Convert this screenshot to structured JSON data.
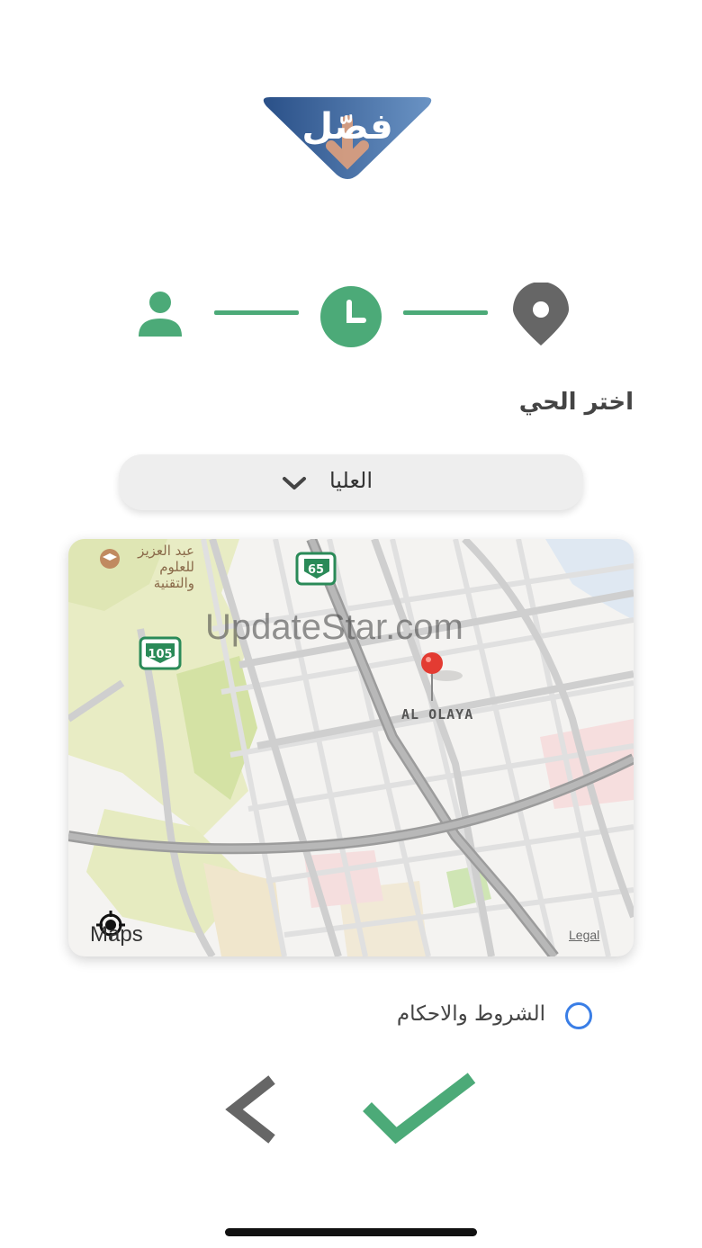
{
  "logo": {
    "text": "فصّل"
  },
  "form": {
    "neighborhood_label": "اختر الحي",
    "district_selected": "العليا"
  },
  "map": {
    "watermark": "UpdateStar.com",
    "district_label": "AL OLAYA",
    "poi_label_line1": "عبد العزيز",
    "poi_label_line2": "للعلوم",
    "poi_label_line3": "والتقنية",
    "shield_1": "65",
    "shield_2": "105",
    "attribution": "Maps",
    "legal": "Legal"
  },
  "terms": {
    "label": "الشروط والاحكام"
  },
  "colors": {
    "accent_green": "#4caa78",
    "inactive_gray": "#666666",
    "radio_blue": "#3a7ee6",
    "logo_blue": "#2f5f9a"
  },
  "icons": {
    "step1": "user-icon",
    "step2": "clock-icon",
    "step3": "location-pin-icon",
    "back": "chevron-left-icon",
    "confirm": "checkmark-icon"
  }
}
